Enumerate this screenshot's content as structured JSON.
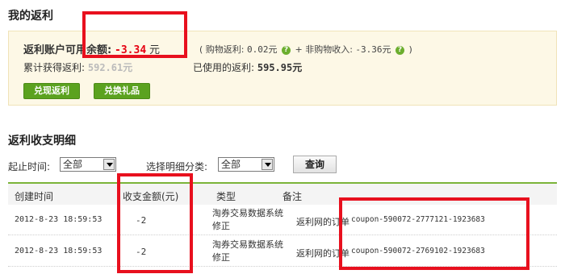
{
  "section1": {
    "title": "我的返利"
  },
  "summary": {
    "balance_label": "返利账户可用余额:",
    "balance_value": "-3.34",
    "balance_unit": "元",
    "detail_prefix": "( 购物返利: ",
    "shopping_value": "0.02元",
    "plus_text": " + 非购物收入: ",
    "nonshopping_value": "-3.36元",
    "detail_suffix": " )",
    "total_label": "累计获得返利:",
    "total_value_partial": "592.61元",
    "used_label": "已使用的返利:",
    "used_value": "595.95元",
    "question_glyph": "?",
    "redeem_button": "兑现返利",
    "gift_button": "兑换礼品"
  },
  "section2": {
    "title": "返利收支明细"
  },
  "filters": {
    "time_label": "起止时间:",
    "time_value": "全部",
    "category_label": "选择明细分类:",
    "category_value": "全部",
    "query_button": "查询"
  },
  "table": {
    "headers": [
      "创建时间",
      "收支金额(元)",
      "类型",
      "备注"
    ],
    "rows": [
      {
        "date": "2012-8-23 18:59:53",
        "amount": "-2",
        "type": "淘券交易数据系统修正",
        "note": "返利网的订单",
        "coupon": "coupon-590072-2777121-1923683"
      },
      {
        "date": "2012-8-23 18:59:53",
        "amount": "-2",
        "type": "淘券交易数据系统修正",
        "note": "返利网的订单",
        "coupon": "coupon-590072-2769102-1923683"
      }
    ]
  },
  "colors": {
    "accent_green": "#5ba21f",
    "negative_red": "#e60012",
    "highlight_box": "#e8101e",
    "summary_bg": "#fdf8e6"
  }
}
